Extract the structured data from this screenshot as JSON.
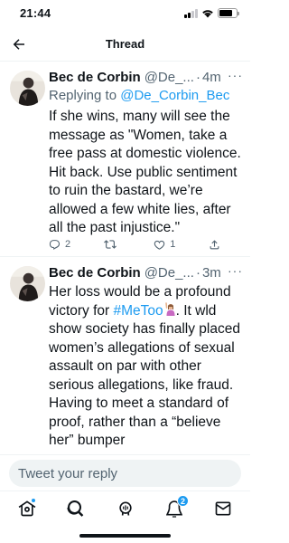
{
  "status_bar": {
    "time": "21:44"
  },
  "header": {
    "title": "Thread"
  },
  "tweets": [
    {
      "name": "Bec de Corbin",
      "handle": "@De_...",
      "separator": "·",
      "time": "4m",
      "more": "···",
      "replying_prefix": "Replying to ",
      "replying_handle": "@De_Corbin_Bec",
      "text": "If she wins, many will see the message as \"Women, take a free pass at domestic violence. Hit back. Use public sentiment to ruin the bastard, we’re allowed a few white lies, after all the past injustice.\"",
      "reply_count": "2",
      "retweet_count": "",
      "like_count": "1"
    },
    {
      "name": "Bec de Corbin",
      "handle": "@De_...",
      "separator": "·",
      "time": "3m",
      "more": "···",
      "text_before": "Her loss would be a profound victory for ",
      "hashtag": "#MeToo",
      "emoji_icon": "woman-raising-hand-emoji",
      "text_after": ". It wld show society has finally placed women’s allegations of sexual assault on par with other serious allegations, like fraud.  Having to meet a standard of proof, rather than a “believe her” bumper"
    }
  ],
  "composer": {
    "placeholder": "Tweet your reply"
  },
  "bottom_nav": {
    "items": [
      "home-icon",
      "search-icon",
      "spaces-icon",
      "notifications-icon",
      "messages-icon"
    ],
    "notification_badge": "2"
  },
  "colors": {
    "accent": "#1d9bf0",
    "text": "#0f1419",
    "secondary": "#536471"
  }
}
